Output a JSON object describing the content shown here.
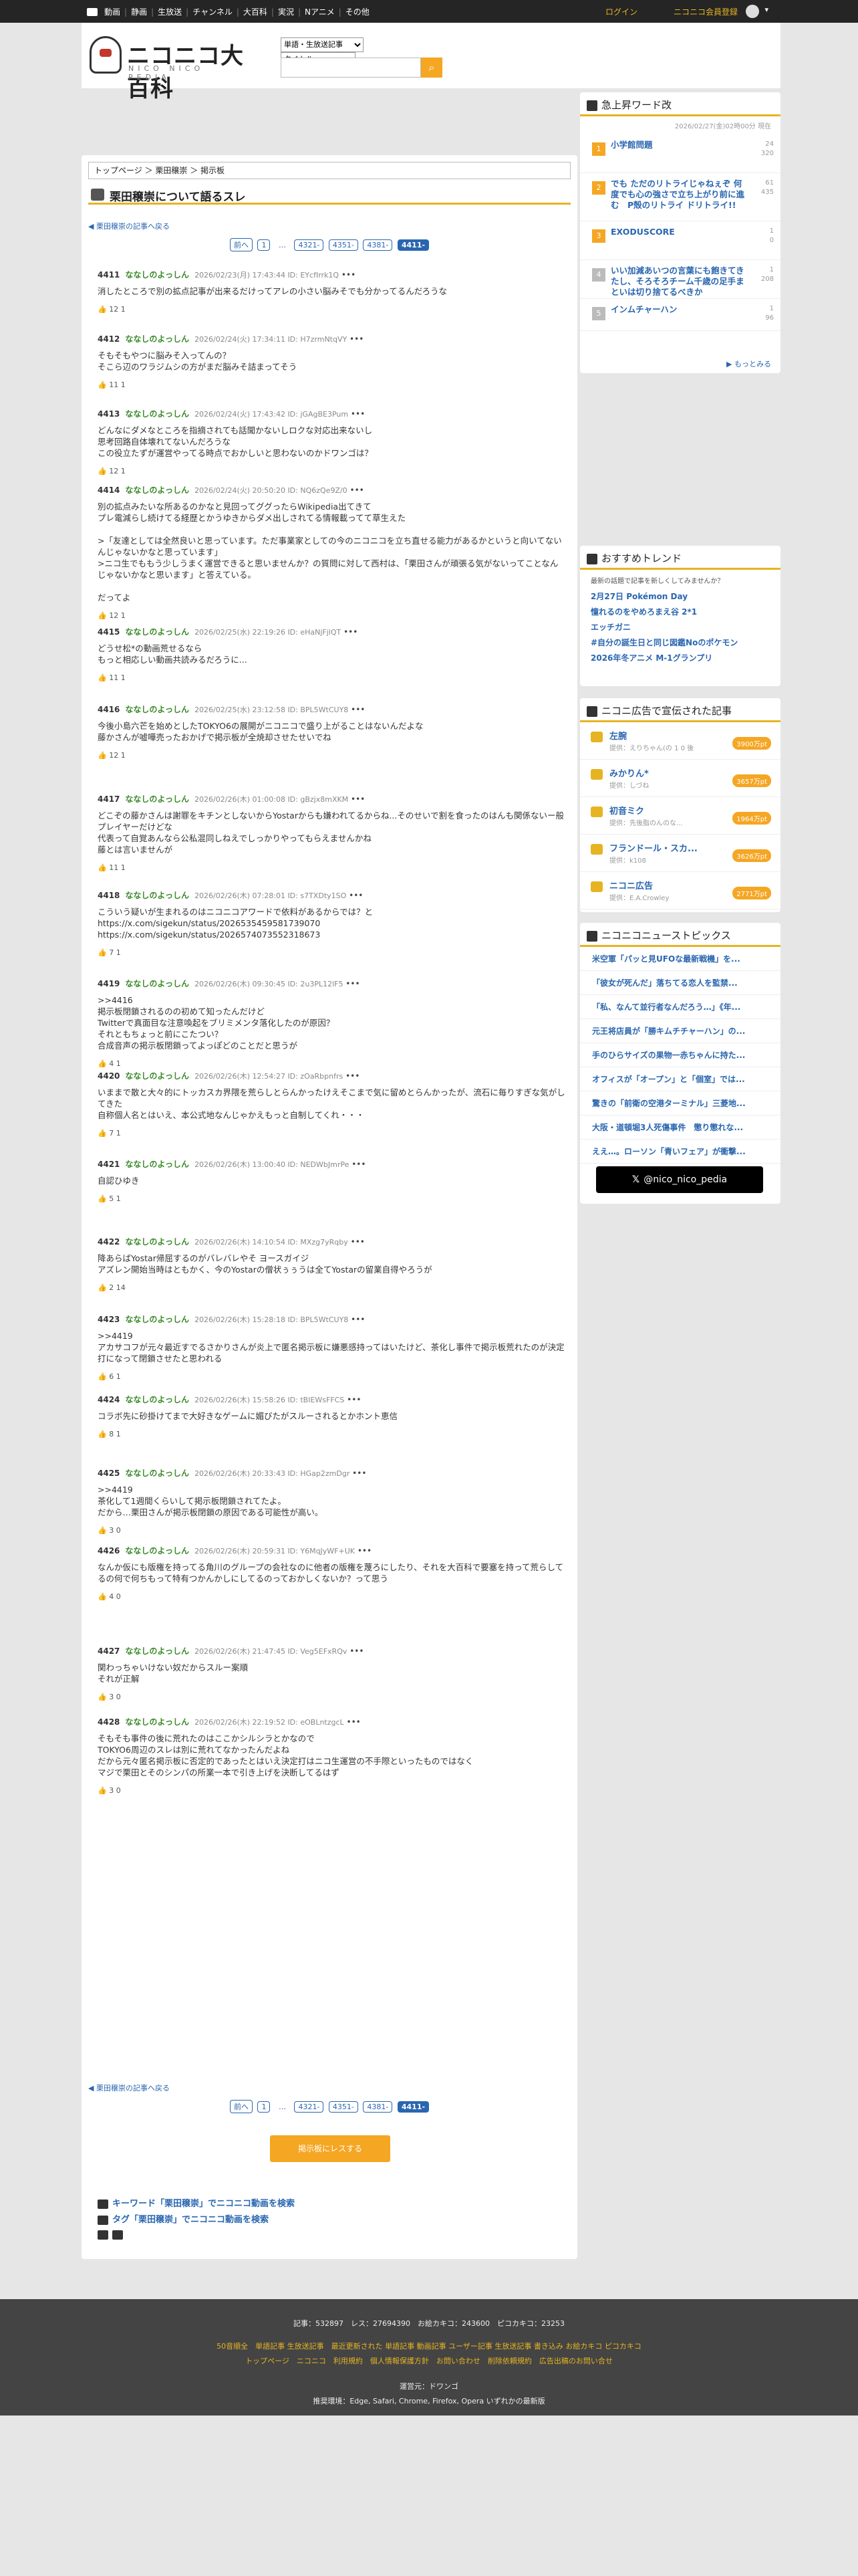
{
  "topbar": {
    "nav": [
      "動画",
      "静画",
      "生放送",
      "チャンネル",
      "大百科",
      "実況",
      "Nアニメ",
      "その他"
    ],
    "login": "ログイン",
    "register": "ニコニコ会員登録"
  },
  "header": {
    "logo": "ニコニコ大百科",
    "logo_sub": "NICO NICO PEDIA",
    "select1": "単語・生放送記事",
    "select2": "タイトル"
  },
  "breadcrumb": "トップページ ＞ 栗田穣崇 ＞ 掲示板",
  "page_title": "栗田穣崇について語るスレ",
  "back_link": "栗田穣崇の記事へ戻る",
  "pager": [
    "前へ",
    "1",
    "…",
    "4321-",
    "4351-",
    "4381-",
    "4411-"
  ],
  "posts": [
    {
      "no": "4411",
      "name": "ななしのよっしん",
      "date": "2026/02/23(月) 17:43:44 ID: EYcfIrrk1Q",
      "body": "消したところで別の拡点記事が出来るだけってアレの小さい脳みそでも分かってるんだろうな",
      "vote": "12  1"
    },
    {
      "no": "4412",
      "name": "ななしのよっしん",
      "date": "2026/02/24(火) 17:34:11 ID: H7zrmNtqVY",
      "body": "そもそもやつに脳みそ入ってんの？\nそこら辺のワラジムシの方がまだ脳みそ詰まってそう",
      "vote": "11  1"
    },
    {
      "no": "4413",
      "name": "ななしのよっしん",
      "date": "2026/02/24(火) 17:43:42 ID: jGAgBE3Pum",
      "body": "どんなにダメなところを指摘されても話聞かないしロクな対応出来ないし\n思考回路自体壊れてないんだろうな\nこの役立たずが運営やってる時点でおかしいと思わないのかドワンゴは？",
      "vote": "12  1"
    },
    {
      "no": "4414",
      "name": "ななしのよっしん",
      "date": "2026/02/24(火) 20:50:20 ID: NQ6zQe9Z/0",
      "body": "別の拡点みたいな所あるのかなと見回ってググったらWikipedia出てきて\nプレ電減らし続けてる経歴とかうゆきからダメ出しされてる情報載ってて草生えた\n\n>「友達としては全然良いと思っています。ただ事業家としての今のニコニコを立ち直せる能力があるかというと向いてないんじゃないかなと思っています」\n>ニコ生でももう少しうまく運営できると思いませんか？の質問に対して西村は、「栗田さんが頑張る気がないってことなんじゃないかなと思います」と答えている。\n\nだってよ",
      "vote": "12  1"
    },
    {
      "no": "4415",
      "name": "ななしのよっしん",
      "date": "2026/02/25(水) 22:19:26 ID: eHaNjFjlQT",
      "body": "どうせ松*の動画荒せるなら\nもっと相応しい動画共読みるだろうに...",
      "vote": "11  1"
    },
    {
      "no": "4416",
      "name": "ななしのよっしん",
      "date": "2026/02/25(水) 23:12:58 ID: BPL5WtCUY8",
      "body": "今後小島六芒を始めとしたTOKYO6の展開がニコニコで盛り上がることはないんだよな\n藤かさんが嘘嘩売ったおかげで掲示板が全焼却させたせいでね",
      "vote": "12  1"
    },
    {
      "no": "4417",
      "name": "ななしのよっしん",
      "date": "2026/02/26(木) 01:00:08 ID: gBzjx8mXKM",
      "body": "どこぞの藤かさんは謝罪をキチンとしないからYostarからも嫌われてるからね...そのせいで割を食ったのはんも関係ないー般プレイヤーだけどな\n代表って自覚あんなら公私混同しねえでしっかりやってもらえませんかね\n藤とは言いませんが",
      "vote": "11  1"
    },
    {
      "no": "4418",
      "name": "ななしのよっしん",
      "date": "2026/02/26(木) 07:28:01 ID: s7TXDty1SO",
      "body": "こういう疑いが生まれるのはニコニコアワードで依料があるからでは？と\nhttps://x.com/sigekun/status/2026535459581739070\nhttps://x.com/sigekun/status/2026574073552318673",
      "vote": "7  1"
    },
    {
      "no": "4419",
      "name": "ななしのよっしん",
      "date": "2026/02/26(木) 09:30:45 ID: 2u3PL12lF5",
      "body": ">>4416\n掲示板閉鎖されるのの初めて知ったんだけど\nTwitterで真面目な注意喚起をブリミメンタ落化したのが原因？\nそれともちょっと前にこたつい？\n合成音声の掲示板閉鎖ってよっぽどのことだと思うが",
      "vote": "4  1"
    },
    {
      "no": "4420",
      "name": "ななしのよっしん",
      "date": "2026/02/26(木) 12:54:27 ID: zOaRbpnfrs",
      "body": "いままで散と大々的にトッカスカ界隈を荒らしとらんかったけえそこまで気に留めとらんかったが、流石に毎りすぎな気がしてきた\n自称個人名とはいえ、本公式地なんじゃかえもっと自制してくれ・・・",
      "vote": "7  1"
    },
    {
      "no": "4421",
      "name": "ななしのよっしん",
      "date": "2026/02/26(木) 13:00:40 ID: NEDWbJmrPe",
      "body": "自認ひゆき",
      "vote": "5  1"
    },
    {
      "no": "4422",
      "name": "ななしのよっしん",
      "date": "2026/02/26(木) 14:10:54 ID: MXzg7yRqby",
      "body": "降あらばYostar帰屈するのがバレバレやそ ヨースガイジ\nアズレン開始当時はともかく、今のYostarの僧状ぅぅうは全てYostarの留業自得やろうが",
      "vote": "2  14"
    },
    {
      "no": "4423",
      "name": "ななしのよっしん",
      "date": "2026/02/26(木) 15:28:18 ID: BPL5WtCUY8",
      "body": ">>4419\nアカサコフが元々最近すでるさかりさんが炎上で匿名掲示板に嫌悪感持ってはいたけど、茶化し事件で掲示板荒れたのが決定打になって閉鎖させたと思われる",
      "vote": "6  1"
    },
    {
      "no": "4424",
      "name": "ななしのよっしん",
      "date": "2026/02/26(木) 15:58:26 ID: tBIEWsFFCS",
      "body": "コラボ先に砂掛けてまで大好きなゲームに媚びたがスルーされるとかホント恵信",
      "vote": "8  1"
    },
    {
      "no": "4425",
      "name": "ななしのよっしん",
      "date": "2026/02/26(木) 20:33:43 ID: HGap2zmDgr",
      "body": ">>4419\n茶化して1週間くらいして掲示板閉鎖されてたよ。\nだから…栗田さんが掲示板閉鎖の原因である可能性が高い。",
      "vote": "3  0"
    },
    {
      "no": "4426",
      "name": "ななしのよっしん",
      "date": "2026/02/26(木) 20:59:31 ID: Y6MqJyWF+UK",
      "body": "なんか仮にも版権を持ってる角川のグループの会社なのに他者の版権を蔑ろにしたり、それを大百科で要塞を持って荒らしてるの何で何ちもって特有つかんかしにしてるのっておかしくないか？って思う",
      "vote": "4  0"
    },
    {
      "no": "4427",
      "name": "ななしのよっしん",
      "date": "2026/02/26(木) 21:47:45 ID: Veg5EFxRQv",
      "body": "関わっちゃいけない奴だからスルー案順\nそれが正解",
      "vote": "3  0"
    },
    {
      "no": "4428",
      "name": "ななしのよっしん",
      "date": "2026/02/26(木) 22:19:52 ID: eOBLntzgcL",
      "body": "そもそも事件の後に荒れたのはここかシルシラとかなので\nTOKYO6周辺のスレは別に荒れてなかったんだよね\nだから元々匿名掲示板に否定的であったとはいえ決定打はニコ生運営の不手際といったものではなく\nマジで栗田とそのシンパの所業一本で引き上げを決断してるはず",
      "vote": "3  0"
    }
  ],
  "publish_button": "掲示板にレスする",
  "bottom_links": [
    "キーワード「栗田穣崇」でニコニコ動画を検索",
    "タグ「栗田穣崇」でニコニコ動画を検索"
  ],
  "sidebar": {
    "hot_title": "急上昇ワード改",
    "hot_date": "2026/02/27(金)02時00分 現在",
    "hot": [
      {
        "rank": "1",
        "word": "小学館問題",
        "stat": "24\n320"
      },
      {
        "rank": "2",
        "word": "でも ただのリトライじゃねぇぞ 何度でも心の強さで立ち上がり前に進む　P殻のリトライ ドリトライ!!",
        "stat": "61\n435"
      },
      {
        "rank": "3",
        "word": "EXODUSCORE",
        "stat": "1\n0"
      },
      {
        "rank": "4",
        "word": "いい加減あいつの言葉にも飽きてきたし、そろそろチーム千歳の足手まといは切り捨てるべきか",
        "stat": "1\n208"
      },
      {
        "rank": "5",
        "word": "インムチャーハン",
        "stat": "1\n96"
      }
    ],
    "more": "もっとみる",
    "trend_title": "おすすめトレンド",
    "trend_sub": "最新の話題で記事を新しくしてみませんか？",
    "trends": [
      "2月27日 Pokémon Day",
      "憧れるのをやめろまえ谷 2*1",
      "エッチガニ",
      "#自分の誕生日と同じ図鑑Noのポケモン",
      "2026年冬アニメ M-1グランプリ"
    ],
    "ads_title": "ニコニ広告で宣伝された記事",
    "ads": [
      {
        "name": "左腕",
        "by": "提供：えりちゃん(の 1 0 後",
        "pt": "3900万pt"
      },
      {
        "name": "みかりん*",
        "by": "提供：しづね",
        "pt": "3657万pt"
      },
      {
        "name": "初音ミク",
        "by": "提供：先後脂のんのな...",
        "pt": "1964万pt"
      },
      {
        "name": "フランドール・スカ...",
        "by": "提供：k108",
        "pt": "3626万pt"
      },
      {
        "name": "ニコニ広告",
        "by": "提供：E.A.Crowley",
        "pt": "2771万pt"
      }
    ],
    "news_title": "ニコニコニューストピックス",
    "news": [
      "米空軍「パッと見UFOな最新戦機」を...",
      "「彼女が死んだ」落ちてる恋人を監禁...",
      "「私、なんて並行者なんだろう…」《年...",
      "元王将店員が「勝キムチチャーハン」の...",
      "手のひらサイズの果物一赤ちゃんに持た...",
      "オフィスが「オープン」と「個室」では...",
      "驚きの「前衛の空港ターミナル」三菱地...",
      "大阪・道頓堀3人死傷事件　懲り懲れな...",
      "ええ…。ローソン「青いフェア」が衝撃..."
    ],
    "x_button": "@nico_nico_pedia"
  },
  "footer": {
    "stats": "記事：532897　レス：27694390　お絵カキコ：243600　ピコカキコ：23253",
    "line2": "50音順全　単語記事 生放送記事　最近更新された 単語記事 動画記事 ユーザー記事 生放送記事 書き込み お絵カキコ ピコカキコ",
    "line3": "トップページ　ニコニコ　利用規約　個人情報保護方針　お問い合わせ　削除依頼規約　広告出稿のお問い合せ",
    "operator": "運営元：ドワンゴ",
    "env": "推奨環境：Edge, Safari, Chrome, Firefox, Opera いずれかの最新版"
  }
}
